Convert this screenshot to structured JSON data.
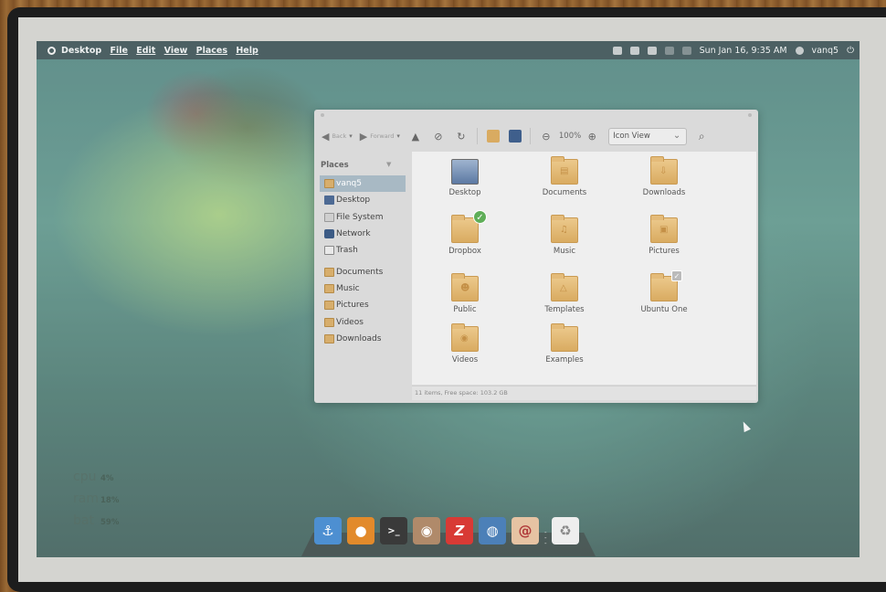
{
  "top_panel": {
    "menu": [
      "Desktop",
      "File",
      "Edit",
      "View",
      "Places",
      "Help"
    ],
    "datetime": "Sun Jan 16,  9:35 AM",
    "user": "vanq5"
  },
  "file_manager": {
    "toolbar": {
      "back_label": "Back",
      "forward_label": "Forward",
      "zoom": "100%",
      "view_mode": "Icon View"
    },
    "sidebar": {
      "heading": "Places",
      "items": [
        "vanq5",
        "Desktop",
        "File System",
        "Network",
        "Trash",
        "Documents",
        "Music",
        "Pictures",
        "Videos",
        "Downloads"
      ]
    },
    "items": [
      "Desktop",
      "Documents",
      "Downloads",
      "Dropbox",
      "Music",
      "Pictures",
      "Public",
      "Templates",
      "Ubuntu One",
      "Videos",
      "Examples"
    ],
    "status": "11 items, Free space: 103.2 GB"
  },
  "system_stats": [
    {
      "label": "cpu",
      "value": "4%"
    },
    {
      "label": "ram",
      "value": "18%"
    },
    {
      "label": "bat",
      "value": "59%"
    }
  ],
  "dock": {
    "apps": [
      "anchor-icon",
      "firefox-icon",
      "terminal-icon",
      "speaker-icon",
      "filezilla-icon",
      "browser-icon",
      "debian-icon",
      "trash-icon"
    ]
  },
  "colors": {
    "panel": "#465055",
    "window_bg": "#dadada",
    "content_bg": "#efefef",
    "folder": "#d9ab61",
    "sidebar_selected": "#a8b9c4",
    "dropbox_badge": "#5fae58"
  }
}
